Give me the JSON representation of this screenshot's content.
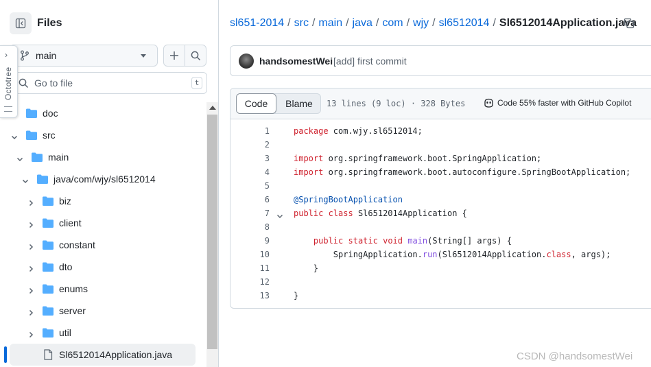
{
  "sidebar": {
    "title": "Files",
    "octotree_label": "Octotree",
    "branch": "main",
    "goto_placeholder": "Go to file",
    "goto_shortcut": "t",
    "tree": [
      {
        "label": "doc",
        "type": "folder",
        "depth": 0,
        "expanded": false
      },
      {
        "label": "src",
        "type": "folder",
        "depth": 0,
        "expanded": true
      },
      {
        "label": "main",
        "type": "folder",
        "depth": 1,
        "expanded": true
      },
      {
        "label": "java/com/wjy/sl6512014",
        "type": "folder",
        "depth": 2,
        "expanded": true
      },
      {
        "label": "biz",
        "type": "folder",
        "depth": 3,
        "expanded": false
      },
      {
        "label": "client",
        "type": "folder",
        "depth": 3,
        "expanded": false
      },
      {
        "label": "constant",
        "type": "folder",
        "depth": 3,
        "expanded": false
      },
      {
        "label": "dto",
        "type": "folder",
        "depth": 3,
        "expanded": false
      },
      {
        "label": "enums",
        "type": "folder",
        "depth": 3,
        "expanded": false
      },
      {
        "label": "server",
        "type": "folder",
        "depth": 3,
        "expanded": false
      },
      {
        "label": "util",
        "type": "folder",
        "depth": 3,
        "expanded": false
      },
      {
        "label": "Sl6512014Application.java",
        "type": "file",
        "depth": 3,
        "active": true
      }
    ]
  },
  "breadcrumb": {
    "parts": [
      "sl651-2014",
      "src",
      "main",
      "java",
      "com",
      "wjy",
      "sl6512014"
    ],
    "current": "Sl6512014Application.java"
  },
  "commit": {
    "author": "handsomestWei",
    "message": "[add] first commit"
  },
  "code_view": {
    "tab_code": "Code",
    "tab_blame": "Blame",
    "file_info": "13 lines (9 loc) · 328 Bytes",
    "copilot": "Code 55% faster with GitHub Copilot",
    "lines": [
      {
        "n": "1",
        "tokens": [
          {
            "t": "package",
            "c": "kw"
          },
          {
            "t": " com.wjy.sl6512014;",
            "c": ""
          }
        ]
      },
      {
        "n": "2",
        "tokens": []
      },
      {
        "n": "3",
        "tokens": [
          {
            "t": "import",
            "c": "kw"
          },
          {
            "t": " org.springframework.boot.SpringApplication;",
            "c": ""
          }
        ]
      },
      {
        "n": "4",
        "tokens": [
          {
            "t": "import",
            "c": "kw"
          },
          {
            "t": " org.springframework.boot.autoconfigure.SpringBootApplication;",
            "c": ""
          }
        ]
      },
      {
        "n": "5",
        "tokens": []
      },
      {
        "n": "6",
        "tokens": [
          {
            "t": "@SpringBootApplication",
            "c": "an"
          }
        ]
      },
      {
        "n": "7",
        "fold": true,
        "tokens": [
          {
            "t": "public",
            "c": "kw"
          },
          {
            "t": " ",
            "c": ""
          },
          {
            "t": "class",
            "c": "kw"
          },
          {
            "t": " Sl6512014Application {",
            "c": ""
          }
        ]
      },
      {
        "n": "8",
        "tokens": []
      },
      {
        "n": "9",
        "tokens": [
          {
            "t": "    ",
            "c": ""
          },
          {
            "t": "public",
            "c": "kw"
          },
          {
            "t": " ",
            "c": ""
          },
          {
            "t": "static",
            "c": "kw"
          },
          {
            "t": " ",
            "c": ""
          },
          {
            "t": "void",
            "c": "kw"
          },
          {
            "t": " ",
            "c": ""
          },
          {
            "t": "main",
            "c": "fn"
          },
          {
            "t": "(String[] args) {",
            "c": ""
          }
        ]
      },
      {
        "n": "10",
        "tokens": [
          {
            "t": "        SpringApplication.",
            "c": ""
          },
          {
            "t": "run",
            "c": "fn"
          },
          {
            "t": "(Sl6512014Application.",
            "c": ""
          },
          {
            "t": "class",
            "c": "kw"
          },
          {
            "t": ", args);",
            "c": ""
          }
        ]
      },
      {
        "n": "11",
        "tokens": [
          {
            "t": "    }",
            "c": ""
          }
        ]
      },
      {
        "n": "12",
        "tokens": []
      },
      {
        "n": "13",
        "tokens": [
          {
            "t": "}",
            "c": ""
          }
        ]
      }
    ]
  },
  "watermark": "CSDN @handsomestWei",
  "colors": {
    "link": "#0969da",
    "folder": "#54aeff",
    "keyword": "#cf222e",
    "annotation": "#0550ae",
    "function": "#8250df"
  }
}
